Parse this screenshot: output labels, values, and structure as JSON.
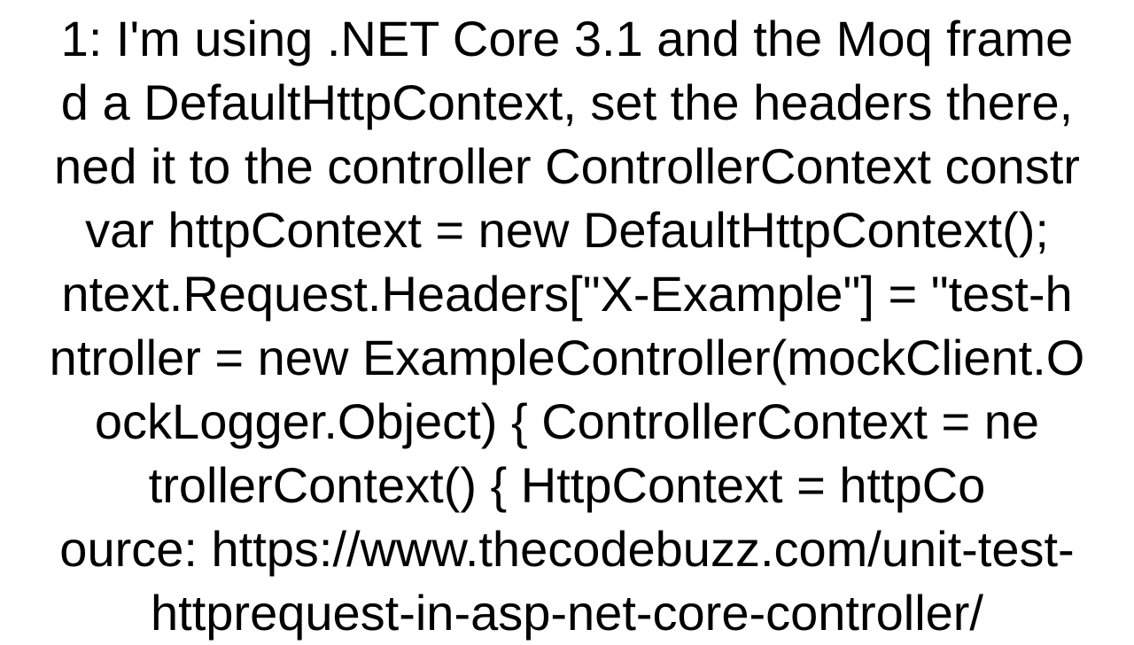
{
  "document": {
    "lines": [
      "1: I'm using .NET Core 3.1 and the Moq frame",
      "d a DefaultHttpContext, set the headers there,",
      "ned it to the controller ControllerContext constr",
      "var httpContext = new DefaultHttpContext();",
      "ntext.Request.Headers[\"X-Example\"] = \"test-h",
      "ntroller = new ExampleController(mockClient.O",
      "ockLogger.Object)  {       ControllerContext = ne",
      "trollerContext()     {         HttpContext = httpCo",
      "ource: https://www.thecodebuzz.com/unit-test-",
      "httprequest-in-asp-net-core-controller/"
    ],
    "source_url": "https://www.thecodebuzz.com/unit-test-mock-httprequest-in-asp-net-core-controller/",
    "framework": ".NET Core 3.1",
    "mocking_library": "Moq",
    "code_elements": {
      "http_context_var": "httpContext",
      "http_context_type": "DefaultHttpContext",
      "header_key": "X-Example",
      "header_value_prefix": "test-h",
      "controller_type": "ExampleController",
      "mock_client": "mockClient",
      "mock_logger": "mockLogger.Object",
      "controller_context": "ControllerContext",
      "http_context_property": "HttpContext"
    }
  }
}
